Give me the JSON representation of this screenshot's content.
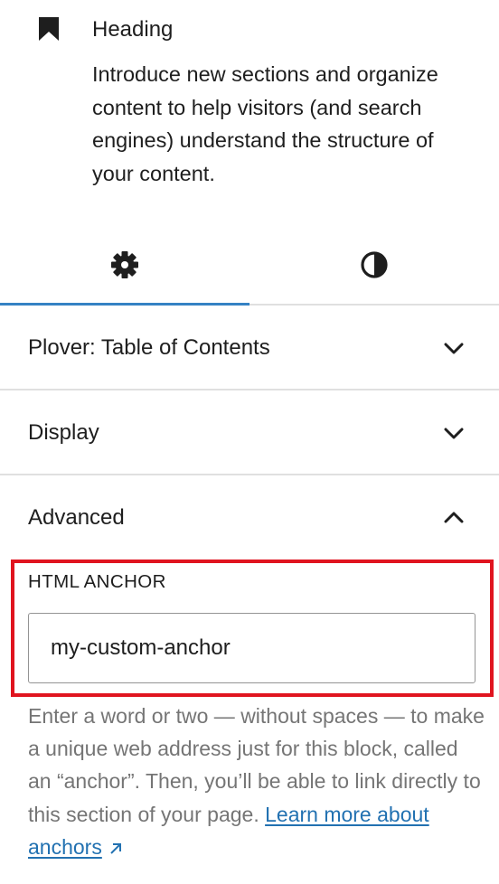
{
  "block_card": {
    "icon": "bookmark-icon",
    "title": "Heading",
    "description": "Introduce new sections and organize content to help visitors (and search engines) understand the structure of your content."
  },
  "tabs": [
    {
      "name": "settings",
      "icon": "gear-icon",
      "active": true
    },
    {
      "name": "styles",
      "icon": "half-circle-contrast-icon",
      "active": false
    }
  ],
  "panels": {
    "toc": {
      "title": "Plover: Table of Contents",
      "expanded": false
    },
    "display": {
      "title": "Display",
      "expanded": false
    },
    "advanced": {
      "title": "Advanced",
      "expanded": true
    }
  },
  "advanced": {
    "html_anchor_label": "HTML ANCHOR",
    "html_anchor_value": "my-custom-anchor",
    "help_text": "Enter a word or two — without spaces — to make a unique web address just for this block, called an “anchor”. Then, you’ll be able to link directly to this section of your page.",
    "help_link_text": "Learn more about anchors",
    "help_link_icon": "external-arrow-icon"
  },
  "colors": {
    "accent": "#3582c4",
    "link": "#2271b1",
    "highlight_border": "#e0141f",
    "muted_text": "#757575"
  }
}
